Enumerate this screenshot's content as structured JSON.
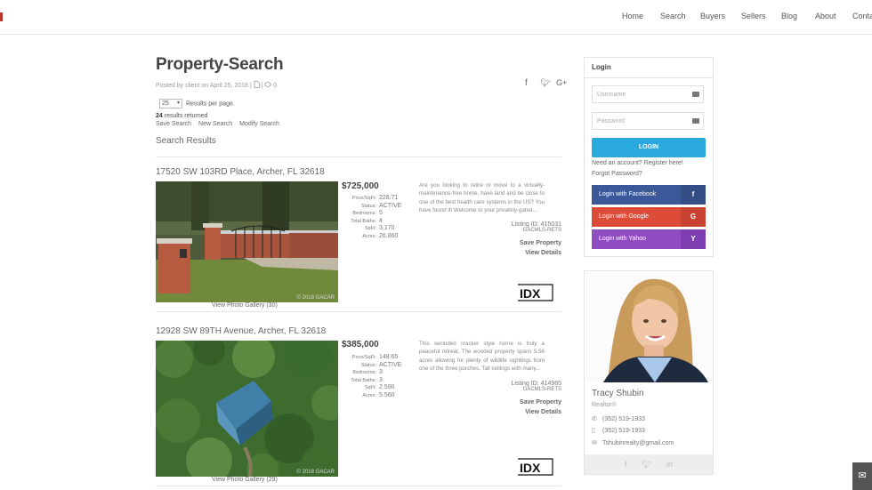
{
  "nav": {
    "items": [
      "Home",
      "Search",
      "Buyers",
      "Sellers",
      "Blog",
      "About",
      "Conta"
    ]
  },
  "page": {
    "title": "Property-Search",
    "posted": "Posted by client on April 25, 2018 |",
    "comments": "0",
    "share_icons": [
      "facebook-icon",
      "twitter-icon",
      "google-plus-icon"
    ]
  },
  "search": {
    "per_page_value": "25",
    "per_page_label": "Results per page.",
    "results_count": "24",
    "results_label": "results returned",
    "links": [
      "Save Search",
      "New Search",
      "Modify Search"
    ],
    "heading": "Search Results"
  },
  "listings": [
    {
      "address": "17520 SW 103RD Place, Archer, FL 32618",
      "price": "$725,000",
      "facts": [
        {
          "k": "Price/SqFt:",
          "v": "228.71"
        },
        {
          "k": "Status:",
          "v": "ACTIVE"
        },
        {
          "k": "Bedrooms:",
          "v": "5"
        },
        {
          "k": "Total Baths:",
          "v": "4"
        },
        {
          "k": "SqFt:",
          "v": "3,170"
        },
        {
          "k": "Acres:",
          "v": "26.860"
        }
      ],
      "description": "Are you looking to retire or move to a virtually-maintenance-free home, have land and be close to one of the best health care systems in the US? You have found it! Welcome to your privately-gated...",
      "listing_id": "Listing ID: 415031",
      "source": "GACMLS-RETS",
      "save": "Save Property",
      "details": "View Details",
      "gallery": "View Photo Gallery (30)",
      "photo_copy": "© 2018 GACAR",
      "idx": "IDX"
    },
    {
      "address": "12928 SW 89TH Avenue, Archer, FL 32618",
      "price": "$385,000",
      "facts": [
        {
          "k": "Price/SqFt:",
          "v": "148.65"
        },
        {
          "k": "Status:",
          "v": "ACTIVE"
        },
        {
          "k": "Bedrooms:",
          "v": "3"
        },
        {
          "k": "Total Baths:",
          "v": "3"
        },
        {
          "k": "SqFt:",
          "v": "2,590"
        },
        {
          "k": "Acres:",
          "v": "5.560"
        }
      ],
      "description": "This secluded cracker style home is truly a peaceful retreat. The wooded property spans 5.56 acres allowing for plenty of wildlife sightings from one of the three porches. Tall ceilings with many...",
      "listing_id": "Listing ID: 414985",
      "source": "GACMLS-RETS",
      "save": "Save Property",
      "details": "View Details",
      "gallery": "View Photo Gallery (29)",
      "photo_copy": "© 2018 GACAR",
      "idx": "IDX"
    }
  ],
  "login": {
    "title": "Login",
    "username_placeholder": "Username",
    "password_placeholder": "Password",
    "button": "LOGIN",
    "register": "Need an account? Register here!",
    "forgot": "Forgot Password?",
    "facebook": "Login with Facebook",
    "facebook_tag": "f",
    "google": "Login with Google",
    "google_tag": "G",
    "yahoo": "Login with Yahoo",
    "yahoo_tag": "Y",
    "colors": {
      "facebook": "#3b5998",
      "google": "#dd4b39",
      "yahoo": "#8e4cc0",
      "login": "#29a9dc"
    }
  },
  "agent": {
    "name": "Tracy Shubin",
    "role": "Realtor®",
    "phone1": "(352) 519-1933",
    "phone2": "(352) 519-1933",
    "email": "Tshubinrealty@gmail.com"
  }
}
